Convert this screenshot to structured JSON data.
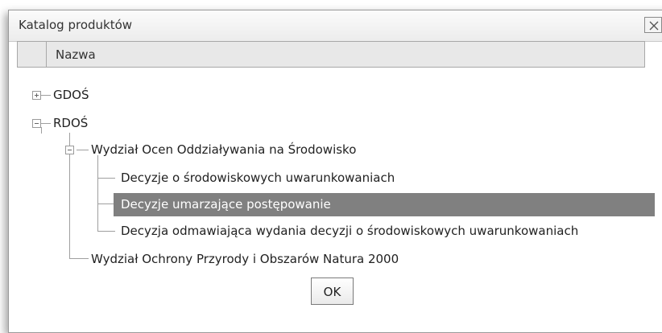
{
  "dialog": {
    "title": "Katalog produktów",
    "close_icon": "close-icon"
  },
  "grid": {
    "column_header": "Nazwa"
  },
  "tree": {
    "nodes": [
      {
        "label": "GDOŚ",
        "level": 0,
        "state": "collapsed"
      },
      {
        "label": "RDOŚ",
        "level": 0,
        "state": "expanded"
      },
      {
        "label": "Wydział Ocen Oddziaływania na Środowisko",
        "level": 1,
        "state": "expanded"
      },
      {
        "label": "Decyzje o środowiskowych uwarunkowaniach",
        "level": 2,
        "state": "leaf"
      },
      {
        "label": "Decyzje umarzające postępowanie",
        "level": 2,
        "state": "leaf",
        "selected": true
      },
      {
        "label": "Decyzja odmawiająca wydania decyzji o środowiskowych uwarunkowaniach",
        "level": 2,
        "state": "leaf"
      },
      {
        "label": "Wydział Ochrony Przyrody i Obszarów Natura 2000",
        "level": 1,
        "state": "leaf"
      }
    ],
    "selected_color": "#808080"
  },
  "footer": {
    "ok_label": "OK"
  }
}
